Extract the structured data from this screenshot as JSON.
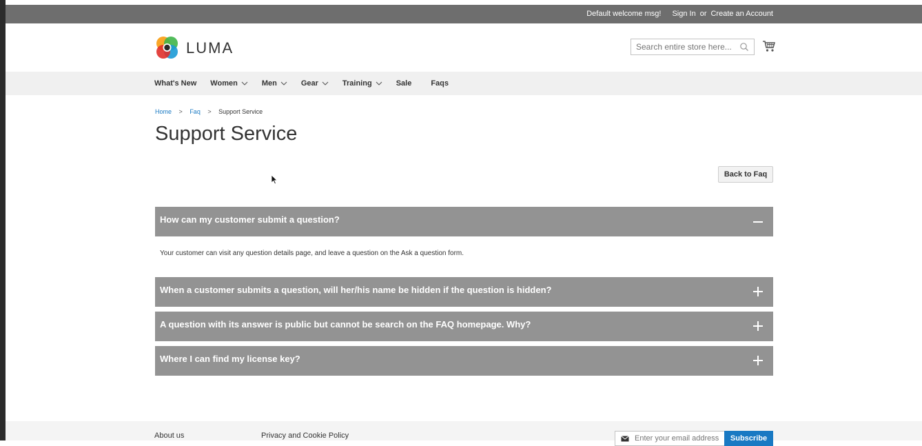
{
  "topbar": {
    "welcome": "Default welcome msg!",
    "sign_in": "Sign In",
    "or": "or",
    "create_account": "Create an Account"
  },
  "header": {
    "logo_text": "LUMA",
    "search_placeholder": "Search entire store here...",
    "search_icon": "search-icon",
    "cart_icon": "cart-icon"
  },
  "nav": {
    "items": [
      {
        "label": "What's New",
        "has_dropdown": false
      },
      {
        "label": "Women",
        "has_dropdown": true
      },
      {
        "label": "Men",
        "has_dropdown": true
      },
      {
        "label": "Gear",
        "has_dropdown": true
      },
      {
        "label": "Training",
        "has_dropdown": true
      },
      {
        "label": "Sale",
        "has_dropdown": false
      },
      {
        "label": "Faqs",
        "has_dropdown": false
      }
    ]
  },
  "breadcrumb": {
    "home": "Home",
    "faq": "Faq",
    "current": "Support Service",
    "separator": ">"
  },
  "page": {
    "title": "Support Service",
    "back_button": "Back to Faq"
  },
  "faqs": [
    {
      "question": "How can my customer submit a question?",
      "expanded": true,
      "answer": "Your customer can visit any question details page, and leave a question on the Ask a question form."
    },
    {
      "question": "When a customer submits a question, will her/his name be hidden if the question is hidden?",
      "expanded": false
    },
    {
      "question": "A question with its answer is public but cannot be search on the FAQ homepage. Why?",
      "expanded": false
    },
    {
      "question": "Where I can find my license key?",
      "expanded": false
    }
  ],
  "footer": {
    "about": "About us",
    "privacy": "Privacy and Cookie Policy",
    "newsletter_placeholder": "Enter your email address",
    "subscribe": "Subscribe"
  },
  "colors": {
    "topbar_bg": "#6e6e6e",
    "nav_bg": "#f0f0f0",
    "faq_bg": "#939393",
    "link": "#1979c3",
    "subscribe_bg": "#1979c3"
  }
}
